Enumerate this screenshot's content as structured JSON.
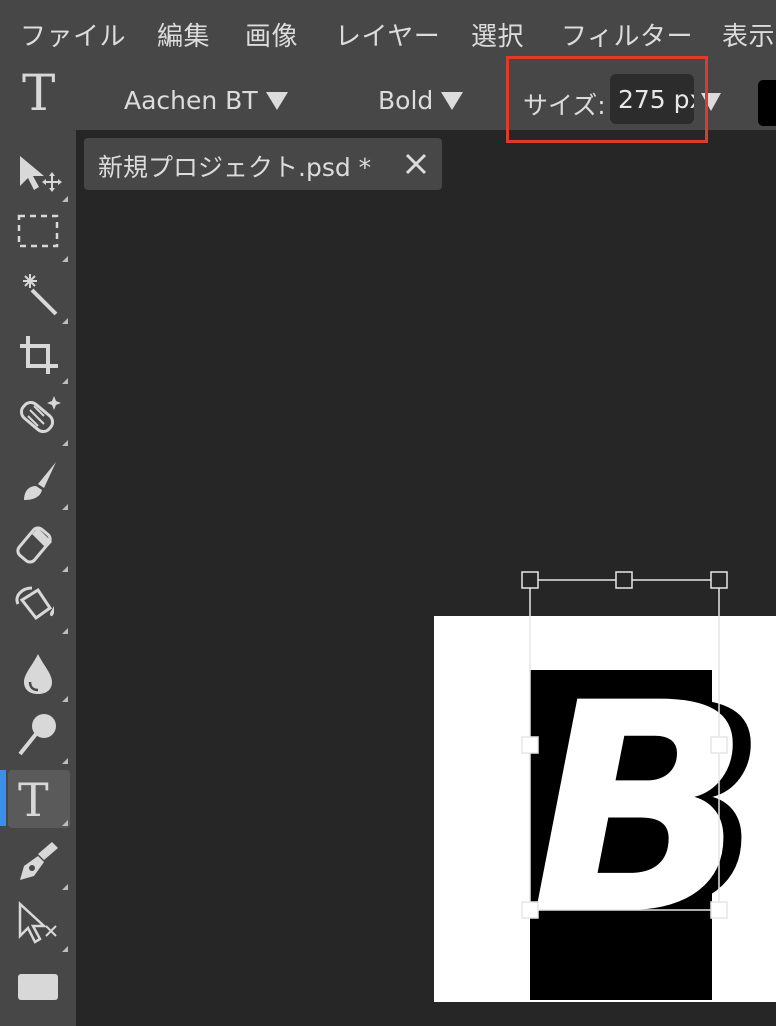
{
  "menu": {
    "items": [
      "ファイル",
      "編集",
      "画像",
      "レイヤー",
      "選択",
      "フィルター",
      "表示"
    ]
  },
  "options": {
    "tool_icon": "type-tool-icon",
    "font_family": "Aachen BT",
    "font_style": "Bold",
    "size_label": "サイズ:",
    "size_value": "275 px"
  },
  "document": {
    "tab_title": "新規プロジェクト.psd *",
    "text_content": "B"
  },
  "toolbar": {
    "tools": [
      "move-tool",
      "marquee-tool",
      "magic-wand-tool",
      "crop-tool",
      "healing-tool",
      "brush-tool",
      "eraser-tool",
      "paint-bucket-tool",
      "blur-tool",
      "dodge-tool",
      "type-tool",
      "pen-tool",
      "direct-select-tool",
      "shape-tool"
    ],
    "active_tool": "type-tool"
  },
  "colors": {
    "accent": "#3d8ee8",
    "highlight": "#e03a2a",
    "foreground": "#000000"
  }
}
